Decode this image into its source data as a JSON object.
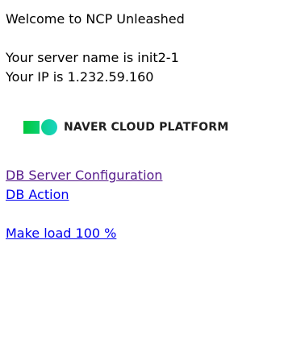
{
  "page": {
    "welcome": "Welcome to NCP Unleashed",
    "server_name_line": "Your server name is init2-1",
    "ip_line": "Your IP is 1.232.59.160"
  },
  "logo": {
    "brand": "NAVER",
    "product": "CLOUD PLATFORM",
    "colors": {
      "left": "#00c73c",
      "right": "#19d4c0"
    }
  },
  "links": {
    "db_config": "DB Server Configuration",
    "db_action": "DB Action",
    "make_load": "Make load 100 %"
  },
  "colors": {
    "link": "#0000ee",
    "visited_link": "#551a8b",
    "text": "#000000"
  }
}
